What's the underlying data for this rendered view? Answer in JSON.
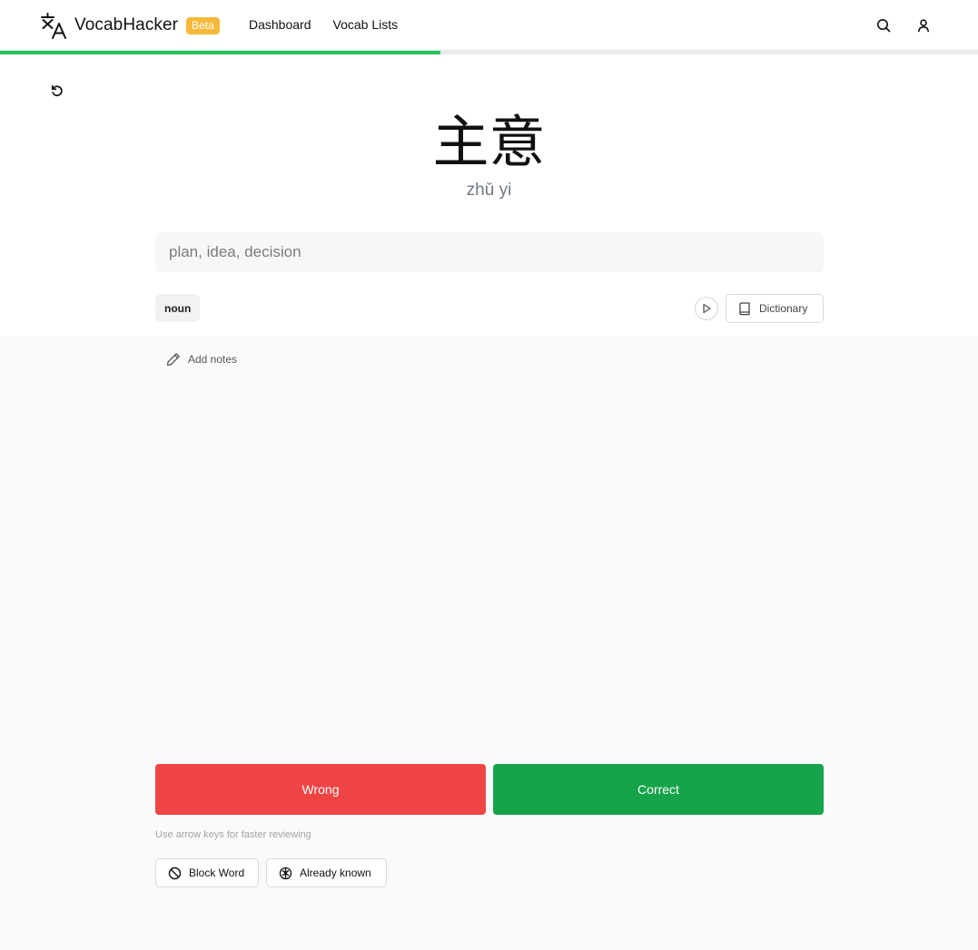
{
  "header": {
    "brand_name": "VocabHacker",
    "beta_label": "Beta",
    "nav": [
      {
        "label": "Dashboard"
      },
      {
        "label": "Vocab Lists"
      }
    ]
  },
  "progress": {
    "fraction": 0.45,
    "color": "#22c55e"
  },
  "card": {
    "hanzi": "主意",
    "pinyin": "zhǔ yi",
    "meaning_placeholder": "plan, idea, decision",
    "meaning_value": "",
    "part_of_speech": "noun",
    "dictionary_label": "Dictionary",
    "add_notes_label": "Add notes"
  },
  "actions": {
    "wrong_label": "Wrong",
    "correct_label": "Correct",
    "hint": "Use arrow keys for faster reviewing",
    "block_label": "Block Word",
    "known_label": "Already known"
  },
  "colors": {
    "wrong": "#ef4444",
    "correct": "#16a34a",
    "beta": "#f6b93b"
  },
  "icons": {
    "logo": "translate-icon",
    "search": "search-icon",
    "user": "user-icon",
    "restart": "restart-icon",
    "play": "play-icon",
    "dictionary": "book-icon",
    "notes": "pencil-icon",
    "block": "ban-icon",
    "known": "brain-icon"
  }
}
